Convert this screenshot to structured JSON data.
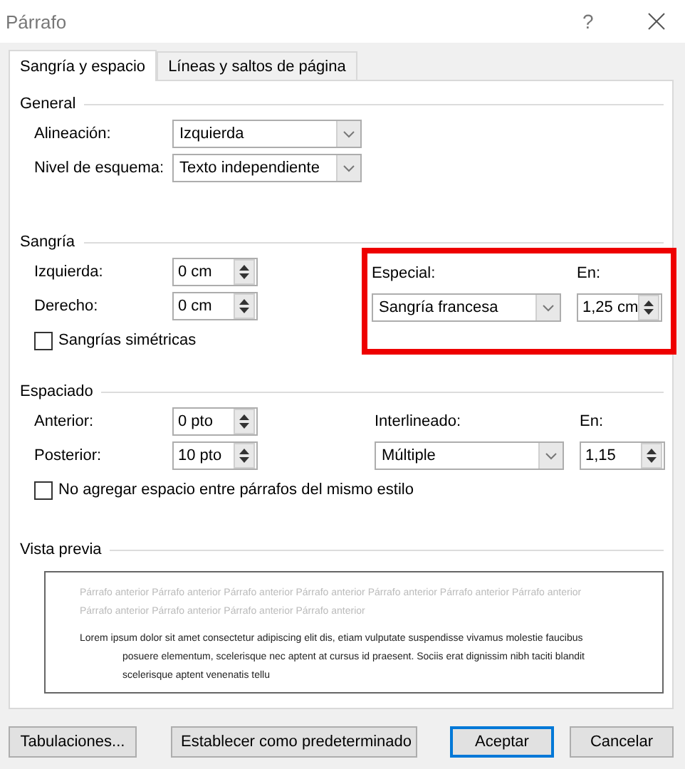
{
  "window": {
    "title": "Párrafo",
    "help": "?"
  },
  "tabs": [
    {
      "label": "Sangría y espacio",
      "selected": true
    },
    {
      "label": "Líneas y saltos de página",
      "selected": false
    }
  ],
  "general": {
    "heading": "General",
    "rows": [
      {
        "label": "Alineación:",
        "value": "Izquierda"
      },
      {
        "label": "Nivel de esquema:",
        "value": "Texto independiente"
      }
    ]
  },
  "indentation": {
    "heading": "Sangría",
    "left": {
      "label": "Izquierda:",
      "value": "0 cm"
    },
    "right": {
      "label": "Derecho:",
      "value": "0 cm"
    },
    "special": {
      "label": "Especial:",
      "value": "Sangría francesa"
    },
    "by": {
      "label": "En:",
      "value": "1,25 cm"
    },
    "highlighted": true,
    "mirror": {
      "label": "Sangrías simétricas",
      "checked": false
    }
  },
  "spacing": {
    "heading": "Espaciado",
    "before": {
      "label": "Anterior:",
      "value": "0 pto"
    },
    "after": {
      "label": "Posterior:",
      "value": "10 pto"
    },
    "line_spacing": {
      "label": "Interlineado:",
      "value": "Múltiple"
    },
    "at": {
      "label": "En:",
      "value": "1,15"
    },
    "no_space": {
      "label": "No agregar espacio entre párrafos del mismo estilo",
      "checked": false
    }
  },
  "preview": {
    "heading": "Vista previa",
    "previous_text": "Párrafo anterior Párrafo anterior Párrafo anterior Párrafo anterior Párrafo anterior Párrafo anterior Párrafo anterior Párrafo anterior Párrafo anterior Párrafo anterior Párrafo anterior",
    "sample_text": "Lorem ipsum dolor sit amet consectetur adipiscing elit dis, etiam vulputate suspendisse vivamus molestie faucibus posuere elementum, scelerisque nec aptent at cursus id praesent. Sociis erat dignissim nibh taciti blandit scelerisque aptent venenatis tellu"
  },
  "buttons": [
    {
      "label": "Tabulaciones...",
      "default": false
    },
    {
      "label": "Establecer como predeterminado",
      "default": false
    },
    {
      "label": "Aceptar",
      "default": true
    },
    {
      "label": "Cancelar",
      "default": false
    }
  ]
}
